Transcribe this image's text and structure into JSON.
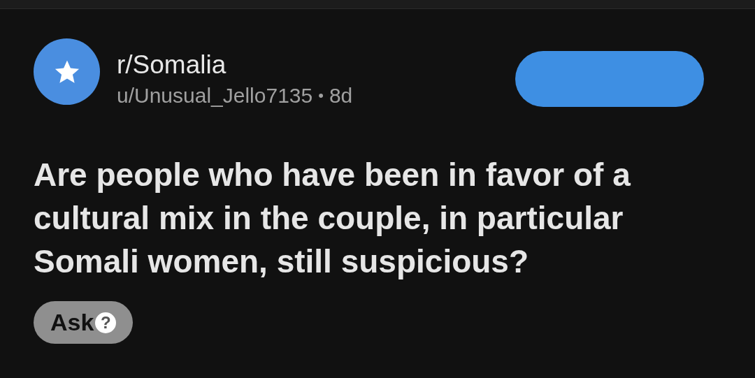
{
  "post": {
    "subreddit": "r/Somalia",
    "author": "u/Unusual_Jello7135",
    "separator": "•",
    "age": "8d",
    "title": "Are people who have been in favor of a cultural mix in the couple, in particular Somali women, still suspicious?",
    "flair": {
      "label": "Ask",
      "icon": "?"
    }
  }
}
